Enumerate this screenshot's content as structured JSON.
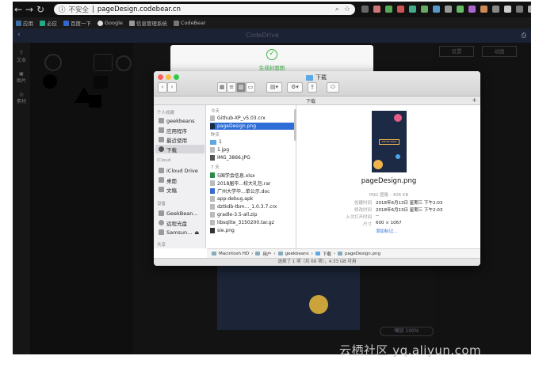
{
  "browser": {
    "security_label": "不安全",
    "url": "pageDesign.codebear.cn",
    "bookmarks": [
      "应用",
      "必应",
      "百度一下",
      "Google",
      "信息管理系统",
      "CodeBear"
    ]
  },
  "finder": {
    "window_title": "下载",
    "column_header": "下载",
    "sidebar": {
      "favorites_header": "个人收藏",
      "favorites": [
        "geekbeans",
        "应用程序",
        "最近使用",
        "下载"
      ],
      "icloud_header": "iCloud",
      "icloud": [
        "iCloud Drive",
        "桌面",
        "文稿"
      ],
      "devices_header": "设备",
      "devices": [
        "GeekBean...",
        "远程光盘",
        "Samsun..."
      ],
      "shared_header": "共享"
    },
    "list": {
      "today_header": "今天",
      "today": [
        "Github-XP_v5.03.crx",
        "pageDesign.png"
      ],
      "yesterday_header": "昨天",
      "yesterday": [
        "1",
        "1.jpg",
        "IMG_3866.JPG"
      ],
      "week_header": "7 天",
      "week": [
        "5国学会信息.xlsx",
        "2018届毕...校大礼包.rar",
        "广州大学毕...单公示.doc",
        "app-debug.apk",
        "dztkdb-tbm..._1.0.3.7.crx",
        "gradle-3.5-all.zip",
        "libsqlite_3150200.tar.gz",
        "sie.png"
      ]
    },
    "preview": {
      "file_name": "pageDesign.png",
      "thumb_button": "ENTER NOW",
      "kind": "PNG 图像 - 406 KB",
      "created_label": "创建时间",
      "created": "2018年6月13日 星期三 下午2:03",
      "modified_label": "修改时间",
      "modified": "2018年6月13日 星期三 下午2:03",
      "opened_label": "上次打开时间",
      "opened": "--",
      "size_label": "尺寸",
      "size": "600 × 1067",
      "add_tags": "添加标记..."
    },
    "path": [
      "Macintosh HD",
      "用户",
      "geekbeans",
      "下载",
      "pageDesign.png"
    ],
    "status": "选择了 1 项（共 68 项），4.33 GB 可用"
  },
  "success": {
    "message": "生成封面图"
  },
  "app": {
    "title": "CodeDrive",
    "left_tools": [
      "文本",
      "图片",
      "素材"
    ],
    "right_tabs": [
      "设置",
      "动画"
    ],
    "zoom_label": "缩放 100%"
  },
  "watermark": "云栖社区 yq.aliyun.com",
  "colors": {
    "selection": "#2f6dd6",
    "success": "#3ab549",
    "folder": "#5aa9e6"
  }
}
